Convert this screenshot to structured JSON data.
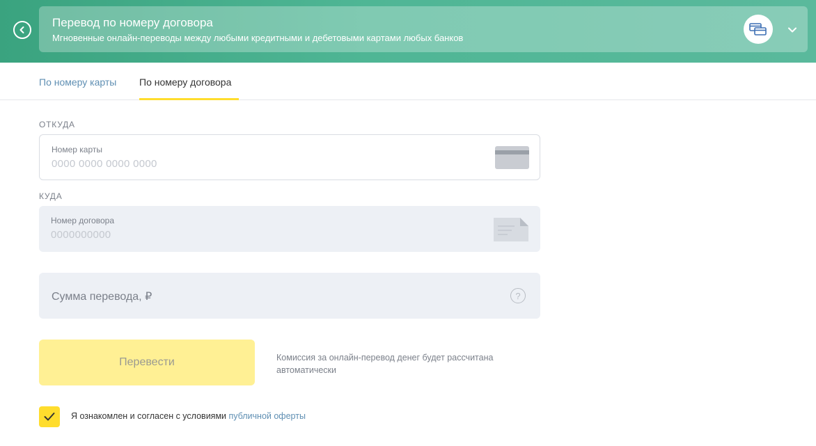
{
  "header": {
    "title": "Перевод по номеру договора",
    "subtitle": "Мгновенные онлайн-переводы между любыми кредитными и дебетовыми картами любых банков",
    "icons": {
      "back": "back-arrow-icon",
      "transfer": "cards-transfer-icon",
      "expand": "chevron-down-icon"
    },
    "colors": {
      "gradient_start": "#3aa37f",
      "gradient_end": "#5ab99c"
    }
  },
  "tabs": [
    {
      "label": "По номеру карты",
      "active": false
    },
    {
      "label": "По номеру договора",
      "active": true
    }
  ],
  "from": {
    "section_label": "ОТКУДА",
    "field_label": "Номер карты",
    "placeholder": "0000 0000 0000 0000",
    "icon": "credit-card-icon"
  },
  "to": {
    "section_label": "КУДА",
    "field_label": "Номер договора",
    "placeholder": "0000000000",
    "icon": "document-icon"
  },
  "amount": {
    "label": "Сумма перевода, ₽",
    "help_glyph": "?",
    "icon": "help-icon"
  },
  "submit": {
    "label": "Перевести"
  },
  "commission_note": "Комиссия за онлайн-перевод денег будет рассчитана автоматически",
  "agreement": {
    "text": "Я ознакомлен и согласен с условиями ",
    "link": "публичной оферты",
    "checked": true
  },
  "accent_color": "#ffdd2d"
}
